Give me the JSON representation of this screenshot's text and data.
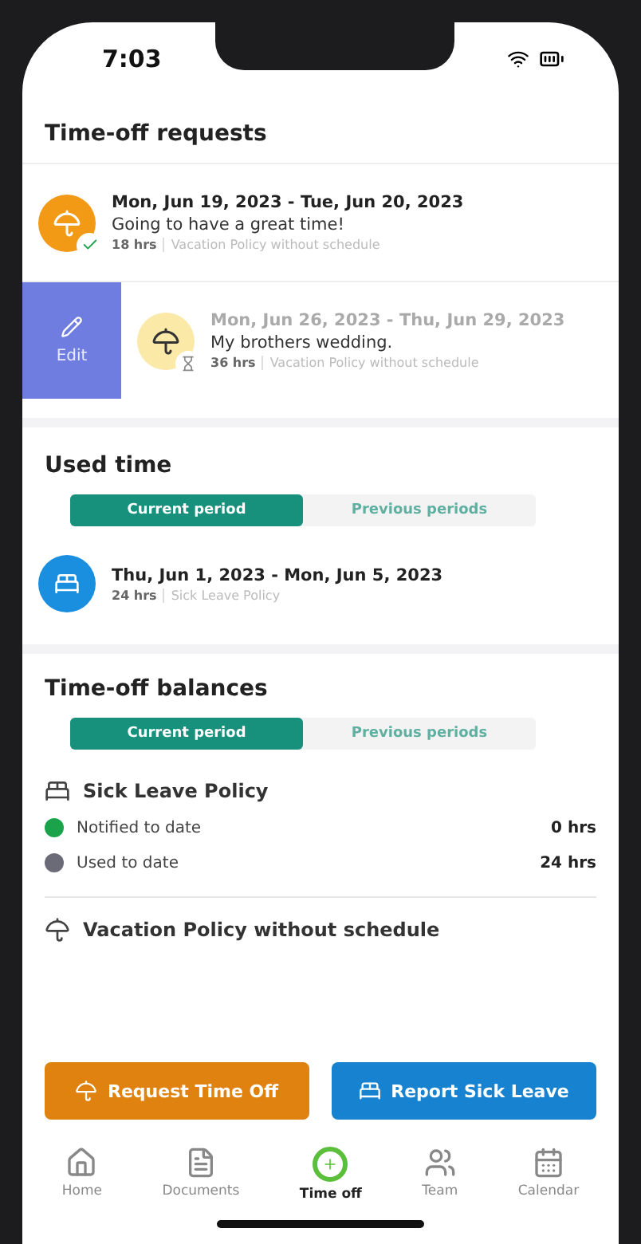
{
  "status_bar": {
    "time": "7:03"
  },
  "requests": {
    "title": "Time-off requests",
    "items": [
      {
        "dates": "Mon, Jun 19, 2023 - Tue, Jun 20, 2023",
        "note": "Going to have a great time!",
        "hours": "18 hrs",
        "policy": "Vacation Policy without schedule",
        "approved": true,
        "swiped": false
      },
      {
        "dates": "Mon, Jun 26, 2023 - Thu, Jun 29, 2023",
        "note": "My brothers wedding.",
        "hours": "36 hrs",
        "policy": "Vacation Policy without schedule",
        "approved": false,
        "swiped": true,
        "action": "Edit"
      }
    ]
  },
  "used_time": {
    "title": "Used time",
    "tabs": [
      {
        "label": "Current period",
        "selected": true
      },
      {
        "label": "Previous periods",
        "selected": false
      }
    ],
    "entries": [
      {
        "dates": "Thu, Jun 1, 2023 - Mon, Jun 5, 2023",
        "hours": "24 hrs",
        "policy": "Sick Leave Policy"
      }
    ]
  },
  "balances": {
    "title": "Time-off balances",
    "tabs": [
      {
        "label": "Current period",
        "selected": true
      },
      {
        "label": "Previous periods",
        "selected": false
      }
    ],
    "policies": [
      {
        "kind": "sick",
        "name": "Sick Leave Policy",
        "rows": [
          {
            "label": "Notified to date",
            "value": "0 hrs",
            "color": "#1aa34a"
          },
          {
            "label": "Used to date",
            "value": "24 hrs",
            "color": "#6b6b78"
          }
        ]
      },
      {
        "kind": "vacation",
        "name": "Vacation Policy without schedule"
      }
    ]
  },
  "actions": [
    {
      "kind": "vacation",
      "label": "Request Time Off"
    },
    {
      "kind": "sick",
      "label": "Report Sick Leave"
    }
  ],
  "nav": [
    {
      "kind": "home",
      "label": "Home",
      "selected": false
    },
    {
      "kind": "documents",
      "label": "Documents",
      "selected": false
    },
    {
      "kind": "timeoff",
      "label": "Time off",
      "selected": true
    },
    {
      "kind": "team",
      "label": "Team",
      "selected": false
    },
    {
      "kind": "calendar",
      "label": "Calendar",
      "selected": false
    }
  ]
}
